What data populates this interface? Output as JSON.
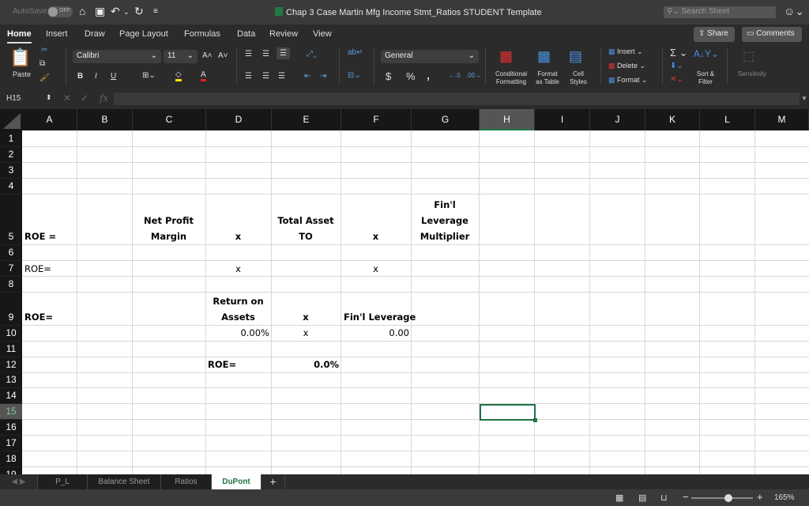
{
  "titlebar": {
    "autosave_label": "AutoSave",
    "autosave_state": "OFF",
    "title": "Chap 3 Case Martin Mfg Income Stmt_Ratios STUDENT Template",
    "search_placeholder": "Search Sheet"
  },
  "menu_tabs": [
    {
      "label": "Home",
      "active": true
    },
    {
      "label": "Insert"
    },
    {
      "label": "Draw"
    },
    {
      "label": "Page Layout"
    },
    {
      "label": "Formulas"
    },
    {
      "label": "Data"
    },
    {
      "label": "Review"
    },
    {
      "label": "View"
    }
  ],
  "top_buttons": {
    "share": "Share",
    "comments": "Comments"
  },
  "ribbon": {
    "paste": "Paste",
    "font_name": "Calibri",
    "font_size": "11",
    "number_format": "General",
    "bold": "B",
    "italic": "I",
    "underline": "U",
    "currency": "$",
    "percent": "%",
    "comma": ",",
    "conditional_formatting": "Conditional Formatting",
    "format_as_table": "Format as Table",
    "cell_styles": "Cell Styles",
    "insert": "Insert",
    "delete": "Delete",
    "format": "Format",
    "sort_filter": "Sort & Filter",
    "sensitivity": "Sensitivity",
    "autosum": "Σ"
  },
  "formula_bar": {
    "name_box": "H15",
    "fx": "fx",
    "value": ""
  },
  "columns": [
    "A",
    "B",
    "C",
    "D",
    "E",
    "F",
    "G",
    "H",
    "I",
    "J",
    "K",
    "L",
    "M"
  ],
  "selected_column": "H",
  "rows": [
    "1",
    "2",
    "3",
    "4",
    "5",
    "6",
    "7",
    "8",
    "9",
    "10",
    "11",
    "12",
    "13",
    "14",
    "15",
    "16",
    "17",
    "18",
    "19"
  ],
  "selected_row": "15",
  "cells": {
    "A5": "ROE =",
    "C5_line1": "Net Profit",
    "C5_line2": "Margin",
    "D5": "x",
    "E5_line1": "Total Asset",
    "E5_line2": "TO",
    "F5": "x",
    "G5_line1": "Fin'l",
    "G5_line2": "Leverage",
    "G5_line3": "Multiplier",
    "A7": "ROE=",
    "D7": "x",
    "F7": "x",
    "A9": "ROE=",
    "D9_line1": "Return on",
    "D9_line2": "Assets",
    "E9": "x",
    "F9": "Fin'l Leverage",
    "D10": "0.00%",
    "E10": "x",
    "F10": "0.00",
    "D12": "ROE=",
    "E12": "0.0%"
  },
  "sheet_tabs": [
    {
      "label": "P_L"
    },
    {
      "label": "Balance Sheet"
    },
    {
      "label": "Ratios"
    },
    {
      "label": "DuPont",
      "active": true
    }
  ],
  "status": {
    "zoom": "165%"
  }
}
